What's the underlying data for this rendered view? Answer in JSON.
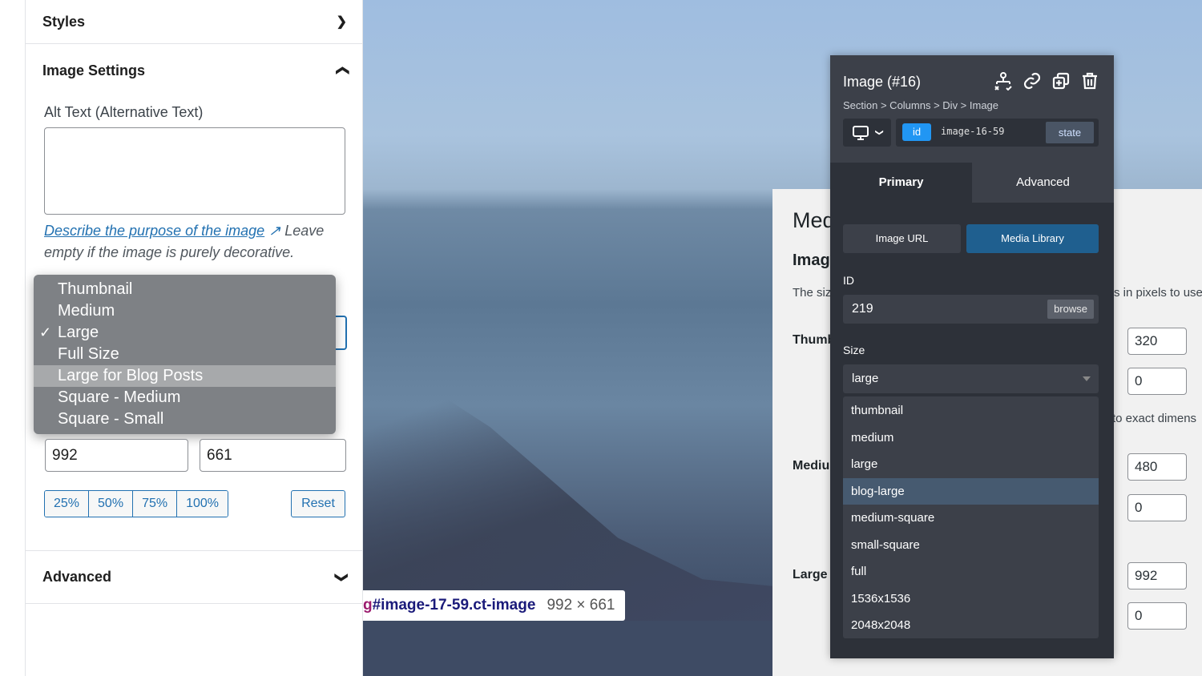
{
  "sidebar": {
    "styles_label": "Styles",
    "image_settings_label": "Image Settings",
    "alt_text_label": "Alt Text (Alternative Text)",
    "alt_text_value": "",
    "help_link": "Describe the purpose of the image",
    "help_text": " Leave empty if the image is purely decorative.",
    "size_options": [
      "Thumbnail",
      "Medium",
      "Large",
      "Full Size",
      "Large for Blog Posts",
      "Square - Medium",
      "Square - Small"
    ],
    "size_selected": "Large",
    "size_hover": "Large for Blog Posts",
    "width": "992",
    "height": "661",
    "pct_buttons": [
      "25%",
      "50%",
      "75%",
      "100%"
    ],
    "reset_label": "Reset",
    "advanced_label": "Advanced"
  },
  "canvas": {
    "selector_prefix": "g",
    "selector": "#image-17-59.ct-image",
    "dimensions": "992 × 661"
  },
  "media_settings": {
    "title": "Med",
    "section": "Imag",
    "desc_left": "The siz",
    "desc_right": "s in pixels to use",
    "thumb_label": "Thumb",
    "thumb_w": "320",
    "thumb_h": "0",
    "crop_text": "to exact dimens",
    "medium_label": "Mediu",
    "medium_w": "480",
    "medium_h": "0",
    "large_label": "Large",
    "large_w": "992",
    "large_h": "0"
  },
  "oxygen": {
    "title": "Image (#16)",
    "breadcrumb": "Section > Columns > Div > Image",
    "id_badge": "id",
    "id_value": "image-16-59",
    "state_label": "state",
    "tabs": [
      "Primary",
      "Advanced"
    ],
    "active_tab": "Primary",
    "source_buttons": [
      "Image URL",
      "Media Library"
    ],
    "active_source": "Media Library",
    "id_label": "ID",
    "id_field": "219",
    "browse_label": "browse",
    "size_label": "Size",
    "size_value": "large",
    "size_options": [
      "thumbnail",
      "medium",
      "large",
      "blog-large",
      "medium-square",
      "small-square",
      "full",
      "1536x1536",
      "2048x2048"
    ],
    "size_hover": "blog-large",
    "accent": "#2196f3",
    "active_button_color": "#1f5f8f"
  }
}
